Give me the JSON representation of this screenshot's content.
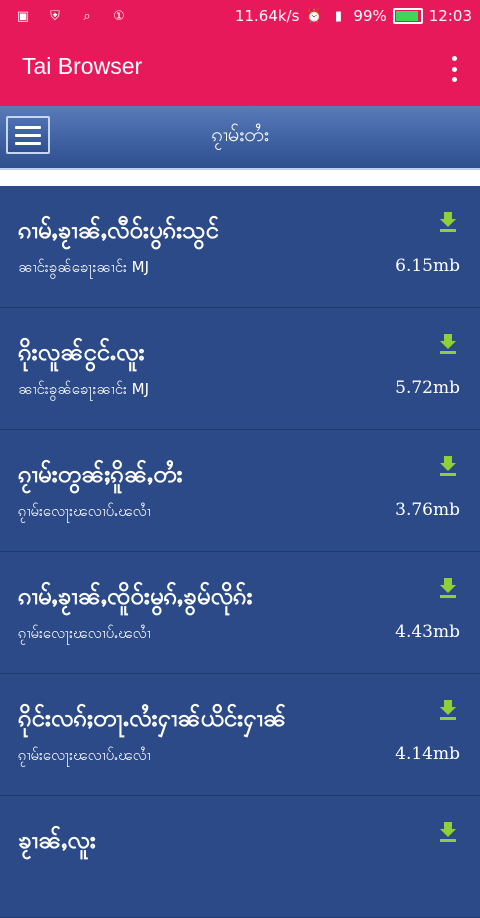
{
  "status_bar": {
    "speed": "11.64k/s",
    "battery_percent": "99%",
    "battery_level": 0.99,
    "time": "12:03",
    "icons": [
      "screenshot-icon",
      "vpn-shield-icon",
      "search-icon",
      "notification-1-icon",
      "alarm-icon",
      "signal-icon",
      "battery-icon"
    ]
  },
  "app_bar": {
    "title": "Tai Browser",
    "menu_icon": "kebab-menu-icon"
  },
  "sub_bar": {
    "title": "ၵႂၢမ်းတႆး",
    "menu_icon": "hamburger-icon"
  },
  "colors": {
    "accent": "#e8195a",
    "list_bg": "#2b4a87",
    "download": "#8ecf3a"
  },
  "songs": [
    {
      "title": "ၵၢမ်ႇၶႂၢၼ်ႇလီဝ်းပွၵ်းသွင်",
      "artist": "ၼၢင်းၶွၼ်ၶေႃးၼၢင်း MJ",
      "size": "6.15mb"
    },
    {
      "title": "ၵိုးလူၼ်ငွင်ႉလူး",
      "artist": "ၼၢင်းၶွၼ်ၶေႃးၼၢင်း MJ",
      "size": "5.72mb"
    },
    {
      "title": "ၵႂၢမ်းတွၼ်ႈၵိူၼ်ႇတႆး",
      "artist": "ၵႂၢမ်းလေႃးၽလၢပ်ႉၽလၢႆ",
      "size": "3.76mb"
    },
    {
      "title": "ၵၢမ်ႇၶႂၢၼ်ႇၸိူဝ်းမွၵ်ႇၶွမ်လိုၵ်း",
      "artist": "ၵႂၢမ်းလေႃးၽလၢပ်ႉၽလၢႆ",
      "size": "4.43mb"
    },
    {
      "title": "ၵိုင်းလၵ်ႈတႃႉလႆးႁၢၼ်ယိင်းႁၢၼ်",
      "artist": "ၵႂၢမ်းလေႃးၽလၢပ်ႉၽလၢႆ",
      "size": "4.14mb"
    },
    {
      "title": "ၶႂၢၼ်ႇလူး",
      "artist": "",
      "size": ""
    }
  ]
}
